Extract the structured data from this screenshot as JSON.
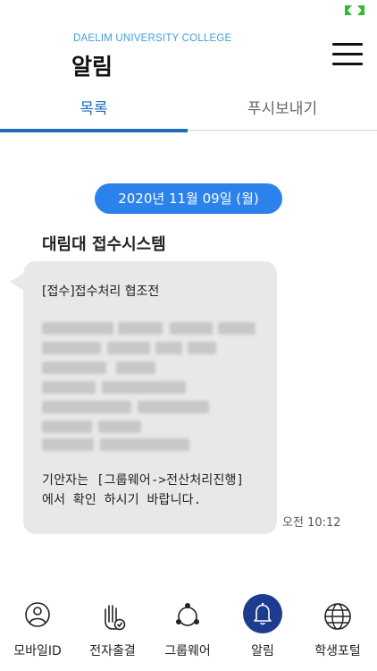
{
  "header": {
    "org": "DAELIM UNIVERSITY COLLEGE",
    "title": "알림",
    "menu_icon": "hamburger-menu-icon"
  },
  "tabs": [
    {
      "label": "목록",
      "active": true
    },
    {
      "label": "푸시보내기",
      "active": false
    }
  ],
  "feed": {
    "date": "2020년 11월 09일 (월)",
    "sender": "대림대 접수시스템",
    "message": {
      "subject": "[접수]접수처리 협조전",
      "footer_line1": "기안자는 [그룹웨어->전산처리진행]",
      "footer_line2": "에서 확인 하시기 바랍니다.",
      "time": "오전 10:12"
    }
  },
  "bottom_nav": [
    {
      "label": "모바일ID",
      "icon": "person-id-icon",
      "active": false
    },
    {
      "label": "전자출결",
      "icon": "hand-check-icon",
      "active": false
    },
    {
      "label": "그룹웨어",
      "icon": "groupware-network-icon",
      "active": false
    },
    {
      "label": "알림",
      "icon": "bell-icon",
      "active": true
    },
    {
      "label": "학생포털",
      "icon": "globe-icon",
      "active": false
    }
  ],
  "colors": {
    "accent": "#1e6bb8",
    "date_pill": "#2a82ea",
    "bubble": "#e8e8e8",
    "active_nav": "#1e3c8f",
    "org_text": "#3ea0d8"
  }
}
